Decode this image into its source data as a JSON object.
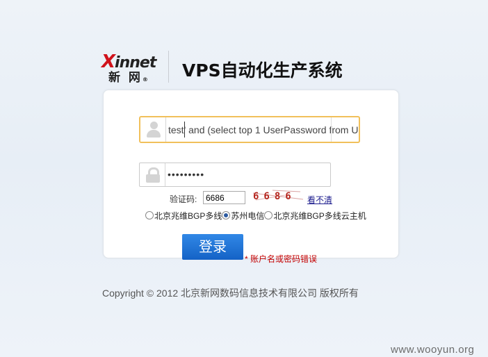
{
  "logo": {
    "brand_x": "X",
    "brand_rest": "innet",
    "brand_cn": "新 网",
    "brand_reg": "®"
  },
  "header": {
    "title": "VPS自动化生产系统"
  },
  "login": {
    "username_value": "test' and (select top 1 UserPassword from U",
    "password_value": "•••••••••",
    "captcha_label": "验证码:",
    "captcha_value": "6686",
    "captcha_image_text": "6686",
    "captcha_refresh": "看不清",
    "servers": [
      {
        "label": "北京兆维BGP多线",
        "selected": false
      },
      {
        "label": "苏州电信",
        "selected": true
      },
      {
        "label": "北京兆维BGP多线云主机",
        "selected": false
      }
    ],
    "submit_label": "登录",
    "error_text": "* 账户名或密码错误"
  },
  "footer": {
    "copyright": "Copyright © 2012 北京新网数码信息技术有限公司 版权所有"
  },
  "watermark": "www.wooyun.org",
  "colors": {
    "accent": "#1f6fd2",
    "error": "#c40000",
    "focus_border": "#f1c05a",
    "logo_red": "#d0121b"
  }
}
